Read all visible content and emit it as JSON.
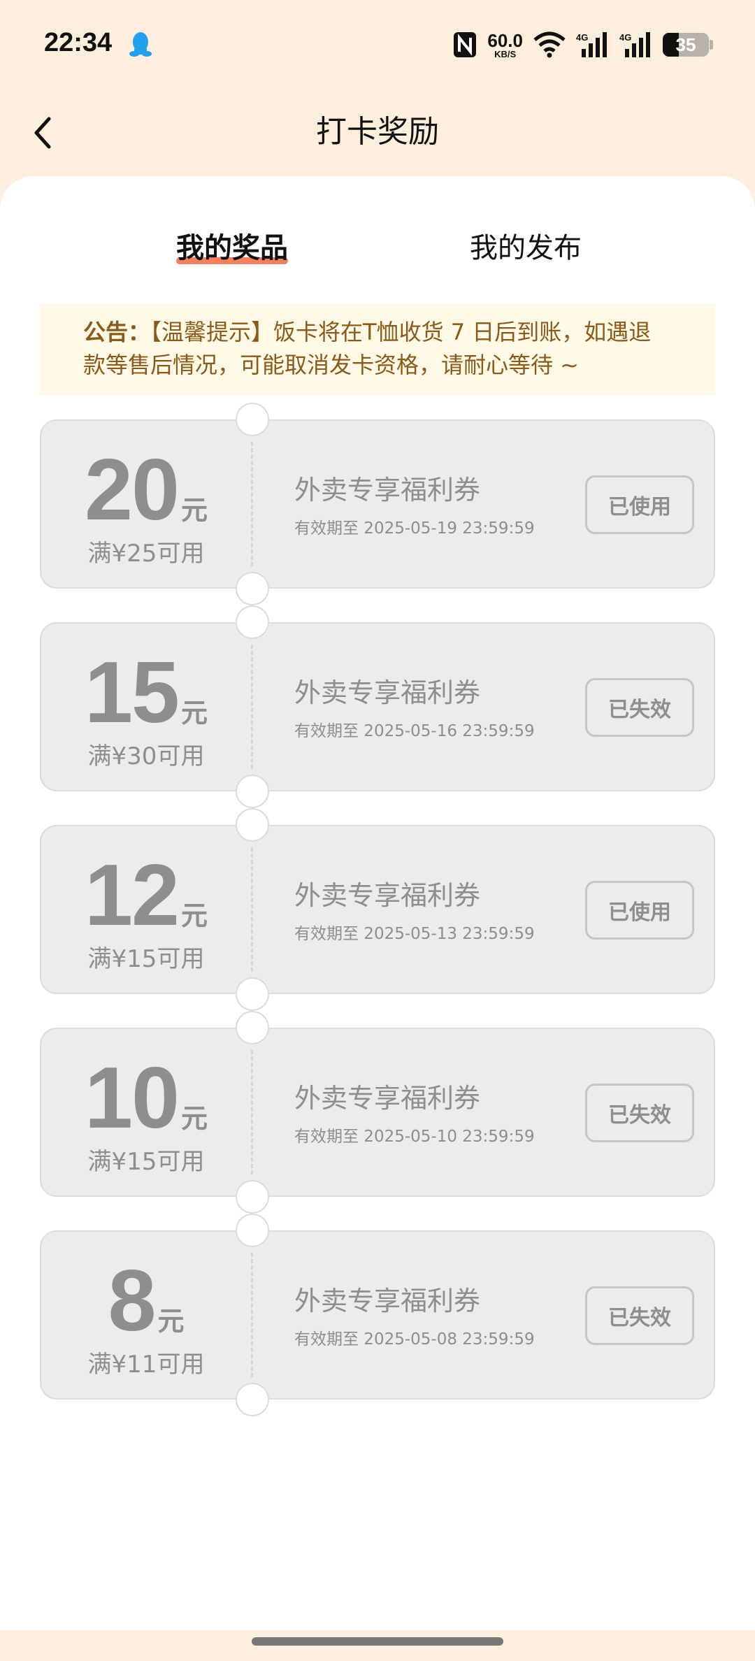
{
  "status_bar": {
    "time": "22:34",
    "net_speed": "60.0",
    "net_unit": "KB/S",
    "signal1": "4G",
    "signal2": "4G",
    "battery": "35"
  },
  "header": {
    "title": "打卡奖励"
  },
  "tabs": [
    {
      "label": "我的奖品",
      "active": true
    },
    {
      "label": "我的发布",
      "active": false
    }
  ],
  "notice": {
    "label": "公告：",
    "text": "【温馨提示】饭卡将在T恤收货 7 日后到账，如遇退款等售后情况，可能取消发卡资格，请耐心等待 ~"
  },
  "coupons": [
    {
      "amount": "20",
      "unit": "元",
      "threshold": "满¥25可用",
      "title": "外卖专享福利券",
      "validity": "有效期至  2025-05-19 23:59:59",
      "status": "已使用"
    },
    {
      "amount": "15",
      "unit": "元",
      "threshold": "满¥30可用",
      "title": "外卖专享福利券",
      "validity": "有效期至  2025-05-16 23:59:59",
      "status": "已失效"
    },
    {
      "amount": "12",
      "unit": "元",
      "threshold": "满¥15可用",
      "title": "外卖专享福利券",
      "validity": "有效期至  2025-05-13 23:59:59",
      "status": "已使用"
    },
    {
      "amount": "10",
      "unit": "元",
      "threshold": "满¥15可用",
      "title": "外卖专享福利券",
      "validity": "有效期至  2025-05-10 23:59:59",
      "status": "已失效"
    },
    {
      "amount": "8",
      "unit": "元",
      "threshold": "满¥11可用",
      "title": "外卖专享福利券",
      "validity": "有效期至  2025-05-08 23:59:59",
      "status": "已失效"
    }
  ],
  "colors": {
    "header_bg": "#fdeedd",
    "tab_underline": "#f08260",
    "notice_bg": "#fff9e6",
    "notice_text": "#8a5a1b",
    "coupon_bg": "#ececec"
  }
}
